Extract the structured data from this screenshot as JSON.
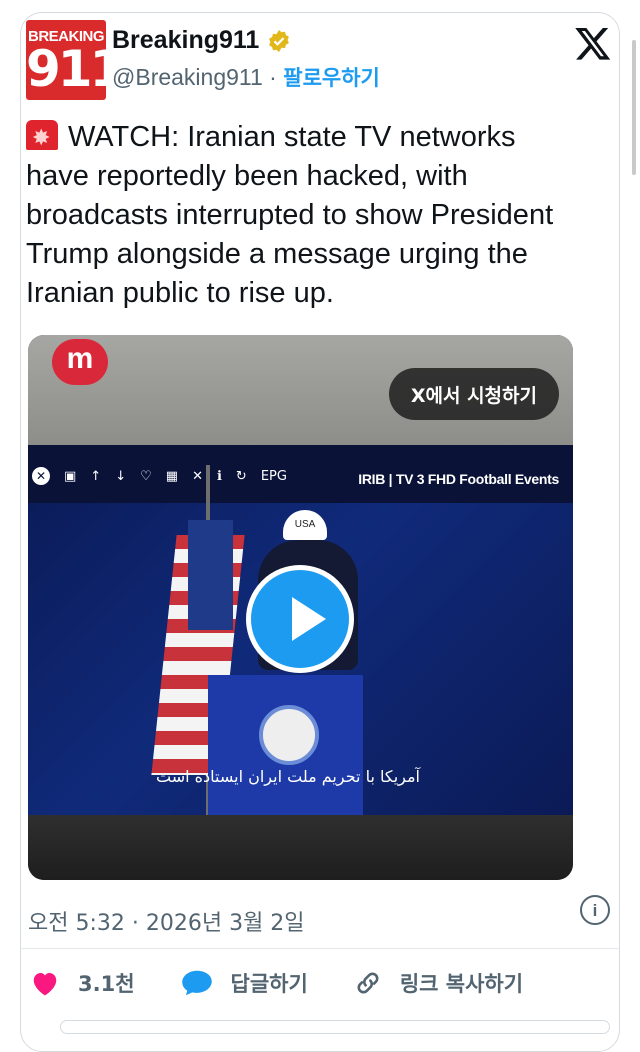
{
  "author": {
    "avatar_top": "BREAKING",
    "avatar_big": "911",
    "name": "Breaking911",
    "handle": "@Breaking911",
    "separator": " · ",
    "follow_label": "팔로우하기"
  },
  "tweet": {
    "text": "WATCH: Iranian state TV networks have reportedly been hacked, with broadcasts interrupted to show President Trump alongside a message urging the Iranian public to rise up."
  },
  "media": {
    "watch_on_x": "X에서 시청하기",
    "channel_label": "IRIB | TV 3 FHD Football Events",
    "toolbar_epg": "EPG",
    "cap_text": "USA",
    "caption": "آمریکا با تحریم ملت ایران ایستاده است",
    "logo": "m"
  },
  "meta": {
    "timestamp": "오전 5:32 · 2026년 3월 2일"
  },
  "actions": {
    "likes": "3.1천",
    "reply": "답글하기",
    "copy_link": "링크 복사하기"
  },
  "colors": {
    "accent": "#1d9bf0",
    "like": "#f91880",
    "brand_red": "#d92b2b"
  }
}
